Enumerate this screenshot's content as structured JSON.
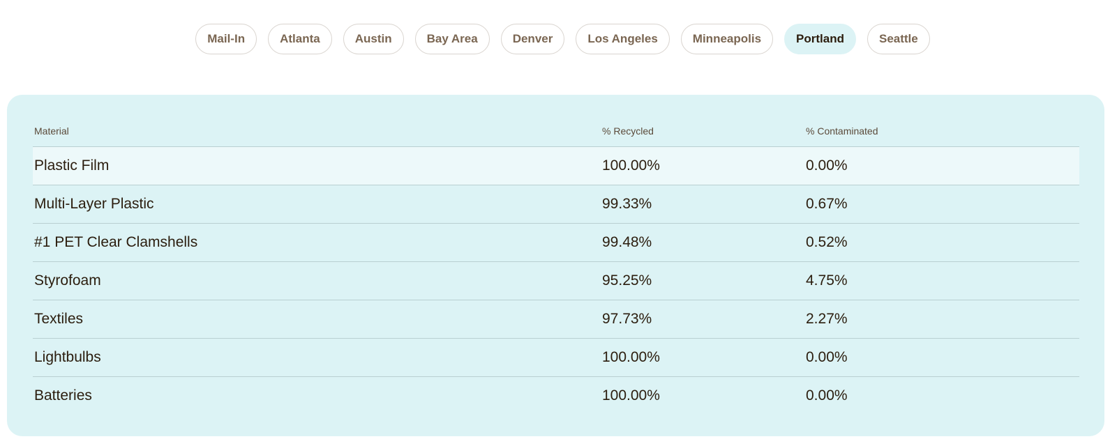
{
  "tabs": [
    {
      "label": "Mail-In",
      "active": false
    },
    {
      "label": "Atlanta",
      "active": false
    },
    {
      "label": "Austin",
      "active": false
    },
    {
      "label": "Bay Area",
      "active": false
    },
    {
      "label": "Denver",
      "active": false
    },
    {
      "label": "Los Angeles",
      "active": false
    },
    {
      "label": "Minneapolis",
      "active": false
    },
    {
      "label": "Portland",
      "active": true
    },
    {
      "label": "Seattle",
      "active": false
    }
  ],
  "table": {
    "headers": {
      "material": "Material",
      "recycled": "% Recycled",
      "contaminated": "% Contaminated"
    },
    "rows": [
      {
        "material": "Plastic Film",
        "recycled": "100.00%",
        "contaminated": "0.00%"
      },
      {
        "material": "Multi-Layer Plastic",
        "recycled": "99.33%",
        "contaminated": "0.67%"
      },
      {
        "material": "#1 PET Clear Clamshells",
        "recycled": "99.48%",
        "contaminated": "0.52%"
      },
      {
        "material": "Styrofoam",
        "recycled": "95.25%",
        "contaminated": "4.75%"
      },
      {
        "material": "Textiles",
        "recycled": "97.73%",
        "contaminated": "2.27%"
      },
      {
        "material": "Lightbulbs",
        "recycled": "100.00%",
        "contaminated": "0.00%"
      },
      {
        "material": "Batteries",
        "recycled": "100.00%",
        "contaminated": "0.00%"
      }
    ]
  },
  "colors": {
    "panel_bg": "#dcf3f5",
    "active_tab_bg": "#dcf3f5",
    "highlight_row_bg": "#edf9fa",
    "tab_text": "#7a6652",
    "body_text": "#2b1d0e"
  }
}
